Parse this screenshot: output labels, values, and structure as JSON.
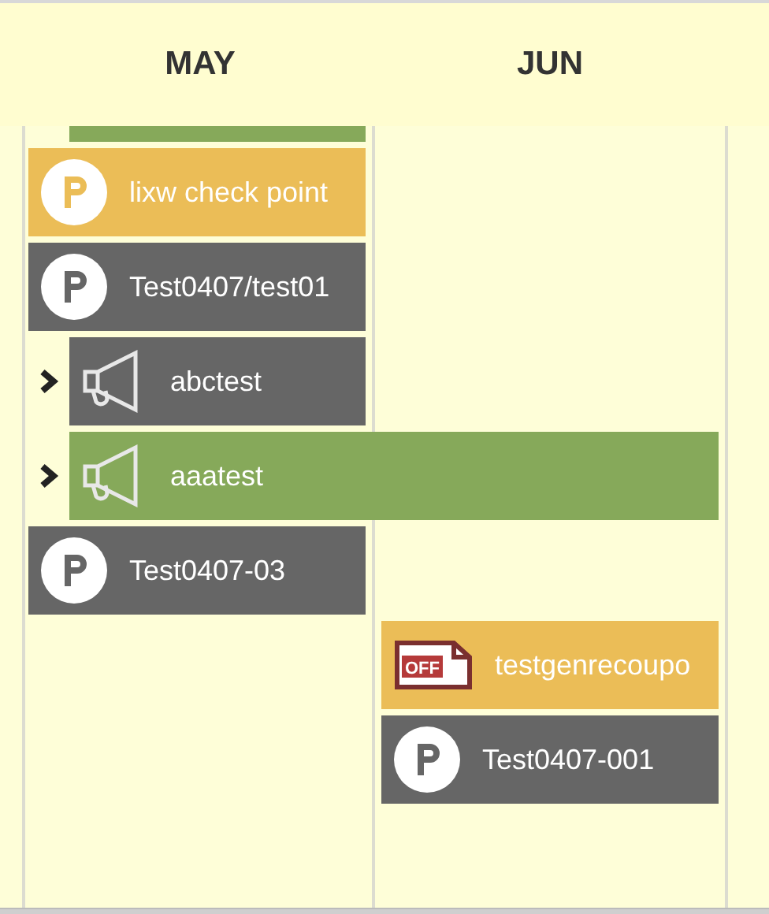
{
  "months": [
    {
      "label": "MAY"
    },
    {
      "label": "JUN"
    }
  ],
  "bars": [
    {
      "kind": "campaign",
      "color": "#86a95a",
      "in_may": true,
      "in_jun": false,
      "partial": true
    },
    {
      "kind": "point",
      "color": "#ebbd57",
      "in_may": true,
      "in_jun": false,
      "label": "lixw check point"
    },
    {
      "kind": "point",
      "color": "#666666",
      "in_may": true,
      "in_jun": false,
      "label": "Test0407/test01"
    },
    {
      "kind": "campaign",
      "color": "#666666",
      "in_may": true,
      "in_jun": false,
      "label": "abctest",
      "expanded": false
    },
    {
      "kind": "campaign",
      "color": "#86a95a",
      "in_may": true,
      "in_jun": true,
      "label": "aaatest",
      "expanded": false
    },
    {
      "kind": "point",
      "color": "#666666",
      "in_may": true,
      "in_jun": false,
      "label": "Test0407-03"
    },
    {
      "kind": "coupon",
      "color": "#ebbd57",
      "in_may": false,
      "in_jun": true,
      "label": "testgenrecoupo",
      "icon_text": "OFF"
    },
    {
      "kind": "point",
      "color": "#666666",
      "in_may": false,
      "in_jun": true,
      "label": "Test0407-001"
    }
  ]
}
